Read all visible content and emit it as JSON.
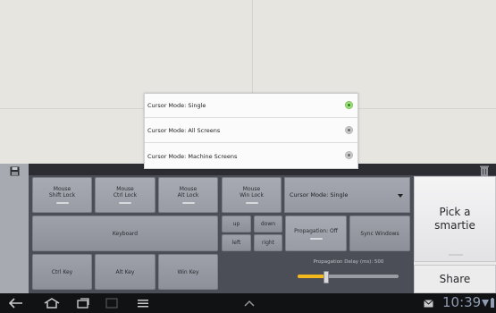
{
  "panel": {
    "mod_buttons": [
      {
        "line1": "Mouse",
        "line2": "Shift Lock"
      },
      {
        "line1": "Mouse",
        "line2": "Ctrl Lock"
      },
      {
        "line1": "Mouse",
        "line2": "Alt Lock"
      },
      {
        "line1": "Mouse",
        "line2": "Win Lock"
      }
    ],
    "keyboard_label": "Keyboard",
    "arrows": {
      "up": "up",
      "down": "down",
      "left": "left",
      "right": "right"
    },
    "propagation_label": "Propagation: Off",
    "sync_label": "Sync Windows",
    "bottom_buttons": [
      "Ctrl Key",
      "Alt Key",
      "Win Key"
    ],
    "cursor_mode_value": "Cursor Mode: Single",
    "propagation_delay_label": "Propagation Delay (ms):  500",
    "propagation_delay_level": 0.27
  },
  "right": {
    "pick_line1": "Pick a",
    "pick_line2": "smartie",
    "share_label": "Share"
  },
  "popup": {
    "options": [
      {
        "label": "Cursor Mode: Single",
        "selected": true
      },
      {
        "label": "Cursor Mode: All Screens",
        "selected": false
      },
      {
        "label": "Cursor Mode: Machine Screens",
        "selected": false
      }
    ]
  },
  "statusbar": {
    "time": "10:39"
  },
  "icons": {
    "save": "save-icon",
    "trash": "trash-icon",
    "back": "back-icon",
    "home": "home-icon",
    "recent": "recent-apps-icon",
    "screenshot": "screenshot-icon",
    "menu": "menu-icon",
    "up": "chevron-up-icon",
    "mail": "mail-icon",
    "wifi": "wifi-icon",
    "battery": "battery-icon"
  },
  "colors": {
    "accent": "#f2b81c",
    "selected_radio": "#1c8a12",
    "panel": "#4c4e57"
  }
}
